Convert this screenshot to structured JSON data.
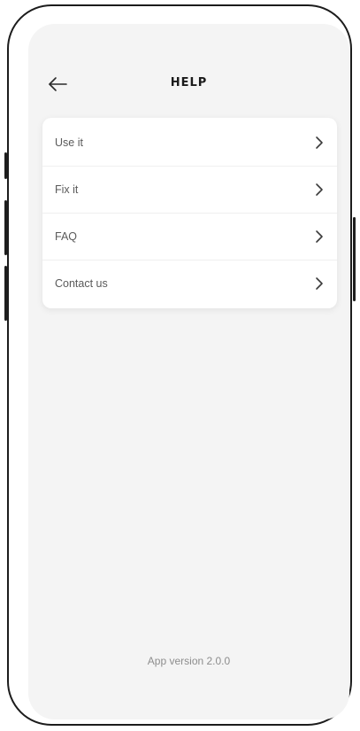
{
  "header": {
    "back_icon": "arrow-left-icon",
    "title": "HELP"
  },
  "menu": {
    "chevron_icon": "chevron-right-icon",
    "items": [
      {
        "label": "Use it"
      },
      {
        "label": "Fix it"
      },
      {
        "label": "FAQ"
      },
      {
        "label": "Contact us"
      }
    ]
  },
  "footer": {
    "version": "App version 2.0.0"
  },
  "colors": {
    "screen_background": "#f4f4f4",
    "card_background": "#ffffff",
    "phone_frame": "#1c1c1c"
  }
}
